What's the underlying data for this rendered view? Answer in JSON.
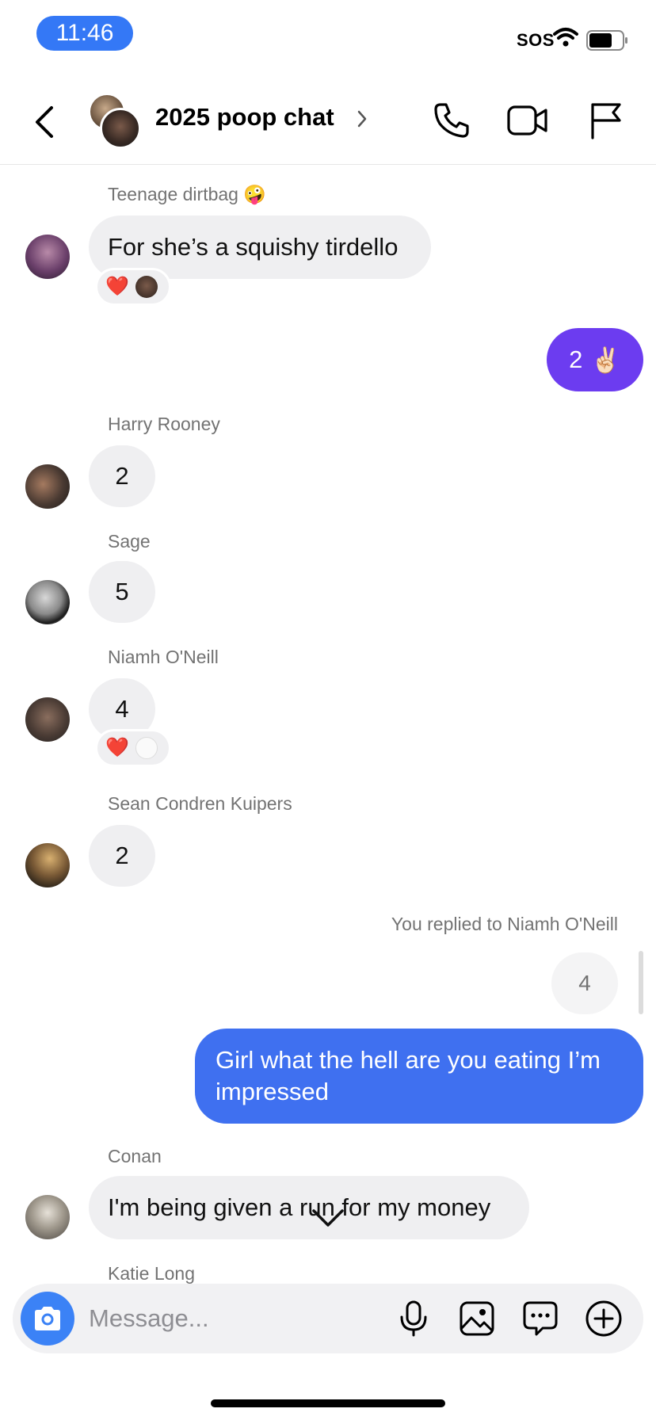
{
  "status_bar": {
    "time": "11:46",
    "sos": "SOS"
  },
  "header": {
    "title": "2025 poop chat"
  },
  "messages": {
    "teenage": {
      "sender": "Teenage dirtbag",
      "sender_emoji": "🤪",
      "text": "For she’s a squishy tirdello",
      "reaction": "❤️"
    },
    "mine1": {
      "text": "2",
      "emoji": "✌🏻"
    },
    "harry": {
      "sender": "Harry Rooney",
      "text": "2"
    },
    "sage": {
      "sender": "Sage",
      "text": "5"
    },
    "niamh": {
      "sender": "Niamh O'Neill",
      "text": "4",
      "reaction": "❤️"
    },
    "sean": {
      "sender": "Sean Condren Kuipers",
      "text": "2"
    },
    "reply": {
      "label": "You replied to Niamh O'Neill",
      "quoted": "4",
      "text": "Girl what the hell are you eating I’m impressed"
    },
    "conan": {
      "sender": "Conan",
      "text": "I'm being given a run for my money"
    },
    "katie": {
      "sender": "Katie Long"
    }
  },
  "composer": {
    "placeholder": "Message..."
  },
  "colors": {
    "outgoing_purple": "#6c3cf0",
    "outgoing_blue": "#3f70f0",
    "incoming_bg": "#efeff1",
    "accent_blue": "#3b82f6"
  },
  "icons": {
    "header": [
      "back-chevron-icon",
      "phone-icon",
      "video-camera-icon",
      "flag-icon"
    ],
    "composer": [
      "camera-icon",
      "microphone-icon",
      "image-icon",
      "sticker-chat-icon",
      "plus-circle-icon"
    ]
  }
}
